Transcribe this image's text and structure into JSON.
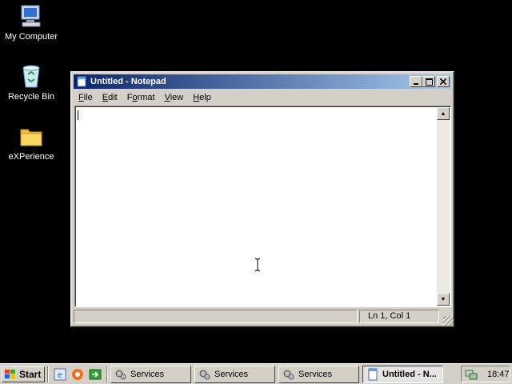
{
  "desktop": {
    "icons": [
      {
        "label": "My Computer",
        "icon": "my-computer-icon"
      },
      {
        "label": "Recycle Bin",
        "icon": "recycle-bin-icon"
      },
      {
        "label": "eXPerience",
        "icon": "folder-icon"
      }
    ]
  },
  "window": {
    "title": "Untitled - Notepad",
    "controls": {
      "minimize": "minimize-icon",
      "maximize": "maximize-icon",
      "close": "close-icon"
    },
    "menu": [
      {
        "key": "F",
        "rest": "ile"
      },
      {
        "key": "E",
        "rest": "dit"
      },
      {
        "key": "o",
        "pre": "F",
        "rest": "rmat"
      },
      {
        "key": "V",
        "rest": "iew"
      },
      {
        "key": "H",
        "rest": "elp"
      }
    ],
    "document_text": "",
    "status": {
      "position": "Ln 1, Col 1"
    }
  },
  "taskbar": {
    "start_label": "Start",
    "quick_launch": [
      "ie-icon",
      "browser-icon",
      "show-desktop-icon"
    ],
    "tasks": [
      {
        "label": "Services",
        "icon": "gears-icon",
        "active": false
      },
      {
        "label": "Services",
        "icon": "gears-icon",
        "active": false
      },
      {
        "label": "Services",
        "icon": "gears-icon",
        "active": false
      },
      {
        "label": "Untitled - N...",
        "icon": "notepad-icon",
        "active": true
      }
    ],
    "tray": {
      "clock": "18:47",
      "icon": "network-icon"
    }
  },
  "colors": {
    "desktop": "#000000",
    "title_start": "#0a246a",
    "title_end": "#a6caf0",
    "face": "#d4d0c8"
  }
}
